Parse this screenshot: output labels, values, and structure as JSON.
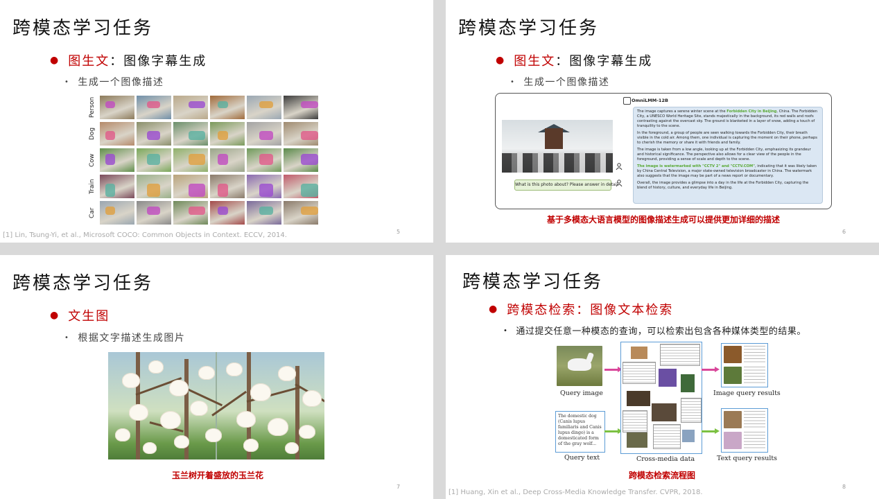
{
  "slides": [
    {
      "title": "跨模态学习任务",
      "bullet_red": "图生文",
      "bullet_sep": "：",
      "bullet_rest": "图像字幕生成",
      "sub": "生成一个图像描述",
      "row_labels": [
        "Person",
        "Dog",
        "Cow",
        "Train",
        "Car"
      ],
      "footnote": "[1] Lin, Tsung-Yi, et al., Microsoft COCO: Common Objects in Context. ECCV, 2014.",
      "page": "5"
    },
    {
      "title": "跨模态学习任务",
      "bullet_red": "图生文",
      "bullet_sep": "：",
      "bullet_rest": "图像字幕生成",
      "sub": "生成一个图像描述",
      "model_name": "OmniLMM-12B",
      "query": "What is this photo about? Please answer in detail.",
      "resp1_pre": "The image captures a serene winter scene at the ",
      "resp1_hl": "Forbidden City in Beijing",
      "resp1_post": ", China. The Forbidden City, a UNESCO World Heritage Site, stands majestically in the background, its red walls and roofs contrasting against the overcast sky. The ground is blanketed in a layer of snow, adding a touch of tranquility to the scene.",
      "resp2": "In the foreground, a group of people are seen walking towards the Forbidden City, their breath visible in the cold air. Among them, one individual is capturing the moment on their phone, perhaps to cherish the memory or share it with friends and family.",
      "resp3": "The image is taken from a low angle, looking up at the Forbidden City, emphasizing its grandeur and historical significance. The perspective also allows for a clear view of the people in the foreground, providing a sense of scale and depth to the scene.",
      "resp4_hl": "The image is watermarked with \"CCTV 2\" and \"CCTV.COM\"",
      "resp4_post": ", indicating that it was likely taken by China Central Television, a major state-owned television broadcaster in China. The watermark also suggests that the image may be part of a news report or documentary.",
      "resp5": "Overall, the image provides a glimpse into a day in the life at the Forbidden City, capturing the blend of history, culture, and everyday life in Beijing.",
      "caption": "基于多模态大语言模型的图像描述生成可以提供更加详细的描述",
      "page": "6"
    },
    {
      "title": "跨模态学习任务",
      "bullet_red": "文生图",
      "sub": "根据文字描述生成图片",
      "caption": "玉兰树开着盛放的玉兰花",
      "page": "7"
    },
    {
      "title": "跨模态学习任务",
      "bullet_red": "跨模态检索：图像文本检索",
      "sub": "通过提交任意一种模态的查询，可以检索出包含各种媒体类型的结果。",
      "labels": {
        "query_image": "Query image",
        "query_text": "Query text",
        "cross_media": "Cross-media data",
        "image_results": "Image query results",
        "text_results": "Text query results"
      },
      "query_text_body": "The domestic dog (Canis lupus familiaris and Canis lupus dingo) is a domesticated form of the gray wolf...",
      "caption": "跨模态检索流程图",
      "footnote": "[1] Huang, Xin et al., Deep Cross-Media Knowledge Transfer. CVPR, 2018.",
      "page": "8"
    }
  ],
  "colors": {
    "accent_red": "#c00000",
    "diagram_blue": "#5b9bd5",
    "highlight_green": "#58a832"
  }
}
